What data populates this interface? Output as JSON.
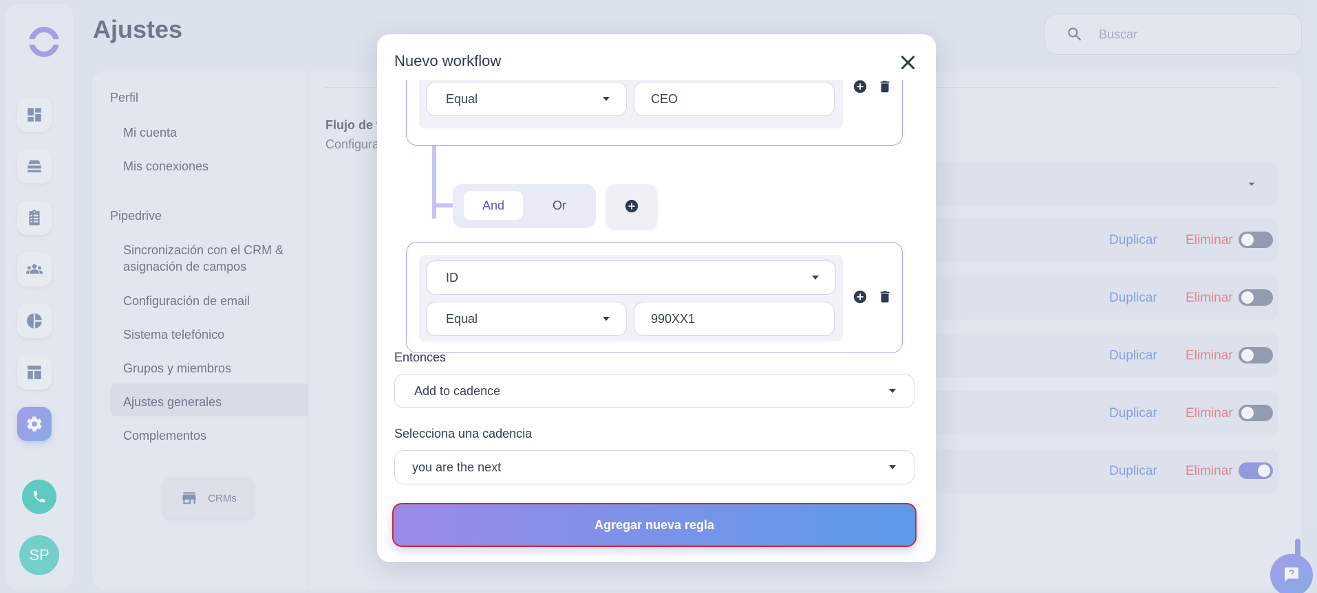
{
  "app": {
    "page_title": "Ajustes",
    "search_placeholder": "Buscar",
    "avatar_initials": "SP"
  },
  "rail": {
    "icons": [
      "dashboard-icon",
      "inbox-icon",
      "clipboard-icon",
      "team-icon",
      "pie-chart-icon",
      "layout-icon",
      "gear-icon"
    ],
    "active": "gear-icon"
  },
  "settings_nav": {
    "sections": [
      {
        "title": "Perfil",
        "items": [
          "Mi cuenta",
          "Mis conexiones"
        ]
      },
      {
        "title": "Pipedrive",
        "items": [
          "Sincronización con el CRM & asignación de campos",
          "Configuración de email",
          "Sistema telefónico",
          "Grupos y miembros",
          "Ajustes generales",
          "Complementos"
        ]
      }
    ],
    "active_item": "Ajustes generales",
    "crm_button": "CRMs"
  },
  "content": {
    "title": "Flujo de t",
    "subtitle": "Configura",
    "rows": [
      {
        "duplicate": "Duplicar",
        "delete": "Eliminar",
        "enabled": false
      },
      {
        "duplicate": "Duplicar",
        "delete": "Eliminar",
        "enabled": false
      },
      {
        "duplicate": "Duplicar",
        "delete": "Eliminar",
        "enabled": false
      },
      {
        "duplicate": "Duplicar",
        "delete": "Eliminar",
        "enabled": false
      },
      {
        "duplicate": "Duplicar",
        "delete": "Eliminar",
        "enabled": true
      }
    ]
  },
  "modal": {
    "title": "Nuevo workflow",
    "condition_1": {
      "operator": "Equal",
      "value": "CEO"
    },
    "logic": {
      "and": "And",
      "or": "Or",
      "selected": "And"
    },
    "condition_2": {
      "field": "ID",
      "operator": "Equal",
      "value": "990XX1"
    },
    "then_label": "Entonces",
    "then_value": "Add to cadence",
    "cadence_label": "Selecciona una cadencia",
    "cadence_value": "you are the next",
    "submit_label": "Agregar nueva regla"
  },
  "colors": {
    "accent_start": "#9a8ae8",
    "accent_end": "#5c9be8",
    "danger": "#e05a66",
    "link": "#5b83d6"
  }
}
